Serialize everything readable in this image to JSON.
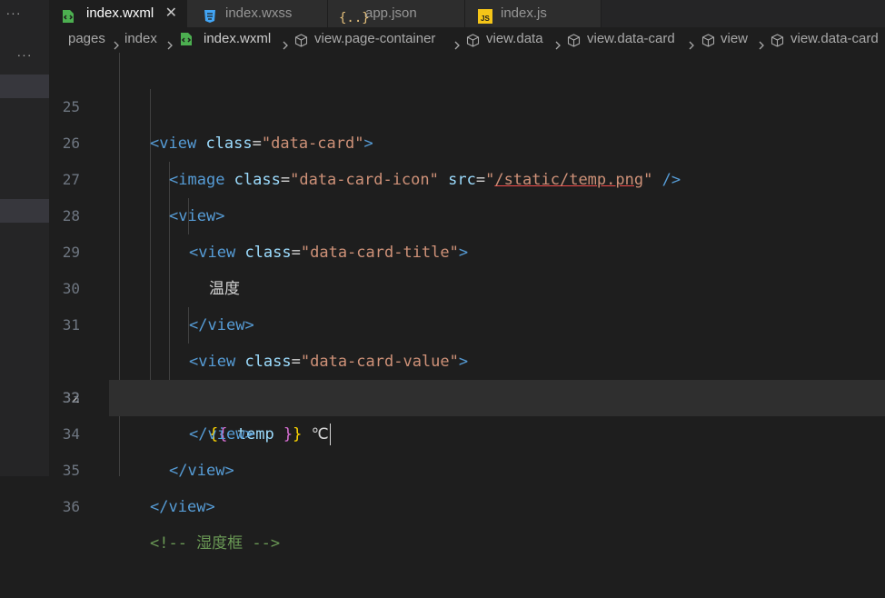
{
  "sidebar": {
    "top_more": "···",
    "mid_more": "···"
  },
  "tabs": [
    {
      "label": "index.wxml",
      "icon": "wxml-file-icon",
      "active": true,
      "close": "✕"
    },
    {
      "label": "index.wxss",
      "icon": "css-file-icon",
      "active": false
    },
    {
      "label": "app.json",
      "icon": "json-file-icon",
      "active": false
    },
    {
      "label": "index.js",
      "icon": "js-file-icon",
      "active": false
    }
  ],
  "breadcrumb": [
    "pages",
    "index",
    "index.wxml",
    "view.page-container",
    "view.data",
    "view.data-card",
    "view",
    "view.data-card"
  ],
  "editor": {
    "current_line": 32,
    "lines": [
      {
        "n": "25",
        "t1": "<",
        "t2": "view",
        "t3": " class",
        "t4": "=",
        "t5": "\"data-card\"",
        "t6": ">"
      },
      {
        "n": "26",
        "t1": "<",
        "t2": "image",
        "t3": " class",
        "t4": "=",
        "t5": "\"data-card-icon\"",
        "t6": " src",
        "t7": "=",
        "t8": "\"",
        "t9": "/static/temp.png",
        "t10": "\"",
        "t11": " />"
      },
      {
        "n": "27",
        "t1": "<",
        "t2": "view",
        "t3": ">"
      },
      {
        "n": "28",
        "t1": "<",
        "t2": "view",
        "t3": " class",
        "t4": "=",
        "t5": "\"data-card-title\"",
        "t6": ">"
      },
      {
        "n": "29",
        "t1": "温度"
      },
      {
        "n": "30",
        "t1": "</",
        "t2": "view",
        "t3": ">"
      },
      {
        "n": "31",
        "t1": "<",
        "t2": "view",
        "t3": " class",
        "t4": "=",
        "t5": "\"data-card-value\"",
        "t6": ">"
      },
      {
        "n": "32",
        "t1": "{",
        "t2": "{",
        "t3": " temp ",
        "t4": "}",
        "t5": "}",
        "t6": " ℃"
      },
      {
        "n": "33",
        "t1": "</",
        "t2": "view",
        "t3": ">"
      },
      {
        "n": "34",
        "t1": "</",
        "t2": "view",
        "t3": ">"
      },
      {
        "n": "35",
        "t1": "</",
        "t2": "view",
        "t3": ">"
      },
      {
        "n": "36",
        "t1": "<!-- 湿度框 -->"
      }
    ]
  },
  "colors": {
    "background": "#1e1e1e",
    "tag": "#569cd6",
    "attribute": "#9cdcfe",
    "string": "#ce9178",
    "comment": "#6a9955",
    "current_line": "#2f2f2f"
  }
}
